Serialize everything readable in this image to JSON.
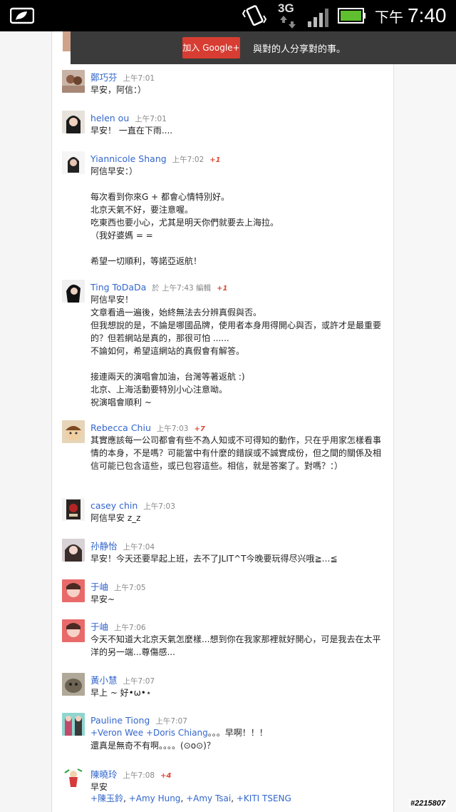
{
  "status_bar": {
    "network": "3G",
    "time_prefix": "下午",
    "time": "7:40"
  },
  "banner": {
    "join_label": "加入 Google+",
    "message": "與對的人分享對的事。"
  },
  "comments": [
    {
      "author": "鄭巧芬",
      "time": "上午7:01",
      "plus": "",
      "body": "早安，阿信：）"
    },
    {
      "author": "helen ou",
      "time": "上午7:01",
      "plus": "",
      "body": "早安！ 一直在下雨...."
    },
    {
      "author": "Yiannicole Shang",
      "time": "上午7:02",
      "plus": "+1",
      "body": "阿信早安：）\n\n每次看到你來G + 都會心情特別好。\n北京天氣不好，要注意喔。\n吃東西也要小心，尤其是明天你們就要去上海拉。\n（我好婆媽 = =\n\n希望一切順利，等諾亞返航！"
    },
    {
      "author": "Ting ToDaDa",
      "time": "於 上午7:43 編輯",
      "plus": "+1",
      "body": "阿信早安！\n文章看過一遍後，始終無法去分辨真假與否。\n但我想說的是，不論是哪國品牌，使用者本身用得開心與否，或許才是最重要的？但若網站是真的，那很可怕 ......\n不論如何，希望這網站的真假會有解答。\n\n接連兩天的演唱會加油，台灣等著返航 :)\n北京、上海活動要特別小心注意呦。\n祝演唱會順利 ~"
    },
    {
      "author": "Rebecca Chiu",
      "time": "上午7:03",
      "plus": "+7",
      "body": "其實應該每一公司都會有些不為人知或不可得知的動作，只在乎用家怎樣看事情的本身，不是嗎？可能當中有什麼的錯誤或不誠實成份，但之間的關係及相信可能已包含這些，或已包容這些。相信，就是答案了。對嗎？：）"
    },
    {
      "author": "casey chin",
      "time": "上午7:03",
      "plus": "",
      "body": "阿信早安 z_z"
    },
    {
      "author": "孙静怡",
      "time": "上午7:04",
      "plus": "",
      "body": "早安！今天还要早起上班，去不了JLIT^T今晚要玩得尽兴哦≧…≦"
    },
    {
      "author": "于岫",
      "time": "上午7:05",
      "plus": "",
      "body": "早安~"
    },
    {
      "author": "于岫",
      "time": "上午7:06",
      "plus": "",
      "body": "今天不知道大北京天氣怎麼樣...想到你在我家那裡就好開心，可是我去在太平洋的另一端...尊傷感..."
    },
    {
      "author": "黃小慧",
      "time": "上午7:07",
      "plus": "",
      "body": "早上 ~ 好•ω•⋆"
    },
    {
      "author": "Pauline Tiong",
      "time": "上午7:07",
      "plus": "",
      "mentions": [
        "+Veron Wee",
        "+Doris Chiang"
      ],
      "body_after": "。。。早啊！！！",
      "body": "還真是無奇不有啊。。。。(⊙o⊙)？"
    },
    {
      "author": "陳曉玲",
      "time": "上午7:08",
      "plus": "+4",
      "body": "早安",
      "mentions": [
        "+陳玉鈴",
        "+Amy Hung",
        "+Amy Tsai",
        "+KITI TSENG"
      ]
    }
  ],
  "watermark": "#2215807"
}
